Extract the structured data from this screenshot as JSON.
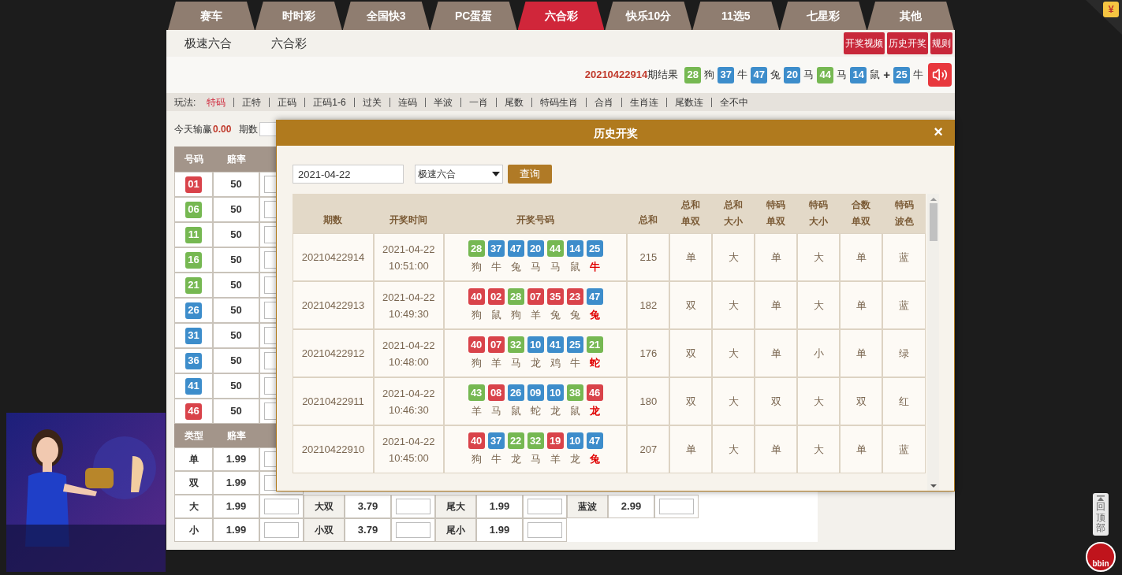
{
  "game_tabs": [
    {
      "label": "赛车",
      "selected": false
    },
    {
      "label": "时时彩",
      "selected": false
    },
    {
      "label": "全国快3",
      "selected": false
    },
    {
      "label": "PC蛋蛋",
      "selected": false
    },
    {
      "label": "六合彩",
      "selected": true
    },
    {
      "label": "快乐10分",
      "selected": false
    },
    {
      "label": "11选5",
      "selected": false
    },
    {
      "label": "七星彩",
      "selected": false
    },
    {
      "label": "其他",
      "selected": false
    }
  ],
  "sub_tabs": [
    "极速六合",
    "六合彩"
  ],
  "action_buttons": [
    "开奖视频",
    "历史开奖",
    "规则"
  ],
  "latest_result": {
    "issue": "20210422914",
    "suffix": "期结果",
    "plus": "+",
    "balls": [
      {
        "number": "28",
        "zodiac": "狗",
        "color": "#76b852"
      },
      {
        "number": "37",
        "zodiac": "牛",
        "color": "#3d8dcb"
      },
      {
        "number": "47",
        "zodiac": "兔",
        "color": "#3d8dcb"
      },
      {
        "number": "20",
        "zodiac": "马",
        "color": "#3d8dcb"
      },
      {
        "number": "44",
        "zodiac": "马",
        "color": "#76b852"
      },
      {
        "number": "14",
        "zodiac": "鼠",
        "color": "#3d8dcb"
      },
      {
        "number": "25",
        "zodiac": "牛",
        "color": "#3d8dcb"
      }
    ]
  },
  "play_types": {
    "label": "玩法:",
    "items": [
      {
        "label": "特码",
        "selected": true
      },
      {
        "label": "正特",
        "selected": false
      },
      {
        "label": "正码",
        "selected": false
      },
      {
        "label": "正码1-6",
        "selected": false
      },
      {
        "label": "过关",
        "selected": false
      },
      {
        "label": "连码",
        "selected": false
      },
      {
        "label": "半波",
        "selected": false
      },
      {
        "label": "一肖",
        "selected": false
      },
      {
        "label": "尾数",
        "selected": false
      },
      {
        "label": "特码生肖",
        "selected": false
      },
      {
        "label": "合肖",
        "selected": false
      },
      {
        "label": "生肖连",
        "selected": false
      },
      {
        "label": "尾数连",
        "selected": false
      },
      {
        "label": "全不中",
        "selected": false
      }
    ]
  },
  "summary": {
    "label": "今天输赢",
    "amount": "0.00",
    "issue_label": "期数"
  },
  "bet_table": {
    "number_header": [
      "号码",
      "赔率"
    ],
    "type_header": [
      "类型",
      "赔率"
    ],
    "number_rows": [
      {
        "number": "01",
        "color": "#d9434a",
        "odds": "50"
      },
      {
        "number": "06",
        "color": "#76b852",
        "odds": "50"
      },
      {
        "number": "11",
        "color": "#76b852",
        "odds": "50"
      },
      {
        "number": "16",
        "color": "#76b852",
        "odds": "50"
      },
      {
        "number": "21",
        "color": "#76b852",
        "odds": "50"
      },
      {
        "number": "26",
        "color": "#3d8dcb",
        "odds": "50"
      },
      {
        "number": "31",
        "color": "#3d8dcb",
        "odds": "50"
      },
      {
        "number": "36",
        "color": "#3d8dcb",
        "odds": "50"
      },
      {
        "number": "41",
        "color": "#3d8dcb",
        "odds": "50"
      },
      {
        "number": "46",
        "color": "#d9434a",
        "odds": "50"
      }
    ],
    "type_rows": [
      [
        {
          "name": "单",
          "odds": "1.99"
        }
      ],
      [
        {
          "name": "双",
          "odds": "1.99"
        }
      ],
      [
        {
          "name": "大",
          "odds": "1.99"
        },
        {
          "name": "大双",
          "odds": "3.79"
        },
        {
          "name": "尾大",
          "odds": "1.99"
        },
        {
          "name": "蓝波",
          "odds": "2.99"
        }
      ],
      [
        {
          "name": "小",
          "odds": "1.99"
        },
        {
          "name": "小双",
          "odds": "3.79"
        },
        {
          "name": "尾小",
          "odds": "1.99"
        }
      ]
    ]
  },
  "history_modal": {
    "title": "历史开奖",
    "close": "×",
    "date": "2021-04-22",
    "lottery": "极速六合",
    "query": "查询",
    "columns": [
      "期数",
      "开奖时间",
      "开奖号码",
      "总和",
      "总和单双",
      "总和大小",
      "特码单双",
      "特码大小",
      "合数单双",
      "特码波色"
    ],
    "rows": [
      {
        "issue": "20210422914",
        "date": "2021-04-22",
        "time": "10:51:00",
        "balls": [
          {
            "number": "28",
            "color": "#76b852"
          },
          {
            "number": "37",
            "color": "#3d8dcb"
          },
          {
            "number": "47",
            "color": "#3d8dcb"
          },
          {
            "number": "20",
            "color": "#3d8dcb"
          },
          {
            "number": "44",
            "color": "#76b852"
          },
          {
            "number": "14",
            "color": "#3d8dcb"
          },
          {
            "number": "25",
            "color": "#3d8dcb"
          }
        ],
        "zodiacs": [
          "狗",
          "牛",
          "兔",
          "马",
          "马",
          "鼠",
          "牛"
        ],
        "values": [
          "215",
          "单",
          "大",
          "单",
          "大",
          "单",
          "蓝"
        ]
      },
      {
        "issue": "20210422913",
        "date": "2021-04-22",
        "time": "10:49:30",
        "balls": [
          {
            "number": "40",
            "color": "#d9434a"
          },
          {
            "number": "02",
            "color": "#d9434a"
          },
          {
            "number": "28",
            "color": "#76b852"
          },
          {
            "number": "07",
            "color": "#d9434a"
          },
          {
            "number": "35",
            "color": "#d9434a"
          },
          {
            "number": "23",
            "color": "#d9434a"
          },
          {
            "number": "47",
            "color": "#3d8dcb"
          }
        ],
        "zodiacs": [
          "狗",
          "鼠",
          "狗",
          "羊",
          "兔",
          "兔",
          "兔"
        ],
        "values": [
          "182",
          "双",
          "大",
          "单",
          "大",
          "单",
          "蓝"
        ]
      },
      {
        "issue": "20210422912",
        "date": "2021-04-22",
        "time": "10:48:00",
        "balls": [
          {
            "number": "40",
            "color": "#d9434a"
          },
          {
            "number": "07",
            "color": "#d9434a"
          },
          {
            "number": "32",
            "color": "#76b852"
          },
          {
            "number": "10",
            "color": "#3d8dcb"
          },
          {
            "number": "41",
            "color": "#3d8dcb"
          },
          {
            "number": "25",
            "color": "#3d8dcb"
          },
          {
            "number": "21",
            "color": "#76b852"
          }
        ],
        "zodiacs": [
          "狗",
          "羊",
          "马",
          "龙",
          "鸡",
          "牛",
          "蛇"
        ],
        "values": [
          "176",
          "双",
          "大",
          "单",
          "小",
          "单",
          "绿"
        ]
      },
      {
        "issue": "20210422911",
        "date": "2021-04-22",
        "time": "10:46:30",
        "balls": [
          {
            "number": "43",
            "color": "#76b852"
          },
          {
            "number": "08",
            "color": "#d9434a"
          },
          {
            "number": "26",
            "color": "#3d8dcb"
          },
          {
            "number": "09",
            "color": "#3d8dcb"
          },
          {
            "number": "10",
            "color": "#3d8dcb"
          },
          {
            "number": "38",
            "color": "#76b852"
          },
          {
            "number": "46",
            "color": "#d9434a"
          }
        ],
        "zodiacs": [
          "羊",
          "马",
          "鼠",
          "蛇",
          "龙",
          "鼠",
          "龙"
        ],
        "values": [
          "180",
          "双",
          "大",
          "双",
          "大",
          "双",
          "红"
        ]
      },
      {
        "issue": "20210422910",
        "date": "2021-04-22",
        "time": "10:45:00",
        "balls": [
          {
            "number": "40",
            "color": "#d9434a"
          },
          {
            "number": "37",
            "color": "#3d8dcb"
          },
          {
            "number": "22",
            "color": "#76b852"
          },
          {
            "number": "32",
            "color": "#76b852"
          },
          {
            "number": "19",
            "color": "#d9434a"
          },
          {
            "number": "10",
            "color": "#3d8dcb"
          },
          {
            "number": "47",
            "color": "#3d8dcb"
          }
        ],
        "zodiacs": [
          "狗",
          "牛",
          "龙",
          "马",
          "羊",
          "龙",
          "兔"
        ],
        "values": [
          "207",
          "单",
          "大",
          "单",
          "大",
          "单",
          "蓝"
        ]
      }
    ]
  },
  "corner_badge": "¥",
  "back_to_top": "回顶部",
  "logo": "bbin"
}
